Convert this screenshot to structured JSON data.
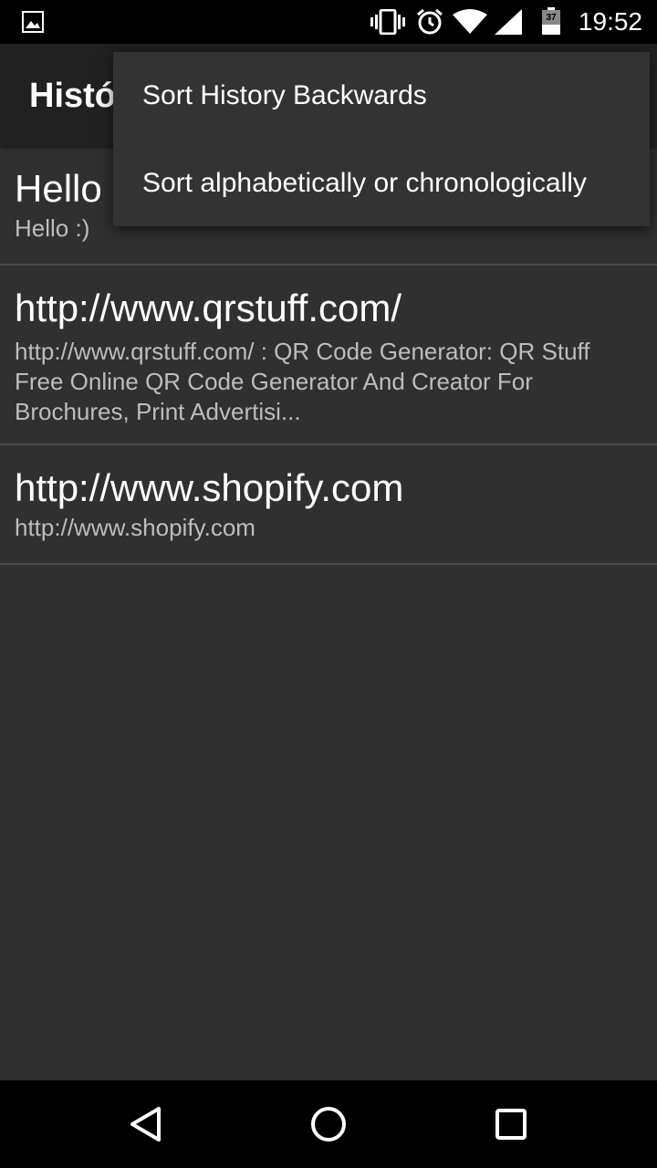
{
  "status_bar": {
    "time": "19:52",
    "battery_level": "37",
    "icons": [
      "image-notification-icon",
      "vibrate-icon",
      "alarm-icon",
      "wifi-icon",
      "cell-signal-icon",
      "battery-icon"
    ]
  },
  "app_bar": {
    "title": "Histó"
  },
  "overflow_menu": {
    "items": [
      {
        "label": "Sort History Backwards"
      },
      {
        "label": "Sort alphabetically or chronologically"
      }
    ]
  },
  "history": {
    "items": [
      {
        "title": "Hello",
        "subtitle": "Hello :)"
      },
      {
        "title": "http://www.qrstuff.com/",
        "subtitle": "http://www.qrstuff.com/ : QR Code Generator: QR Stuff Free Online QR Code Generator And Creator For Brochures, Print Advertisi..."
      },
      {
        "title": "http://www.shopify.com",
        "subtitle": "http://www.shopify.com"
      }
    ]
  },
  "nav_bar": {
    "icons": [
      "back-icon",
      "home-icon",
      "recents-icon"
    ]
  },
  "colors": {
    "background": "#303030",
    "app_bar": "#212121",
    "menu": "#333333",
    "divider": "#4a4a4a",
    "subtitle": "#bdbdbd"
  }
}
